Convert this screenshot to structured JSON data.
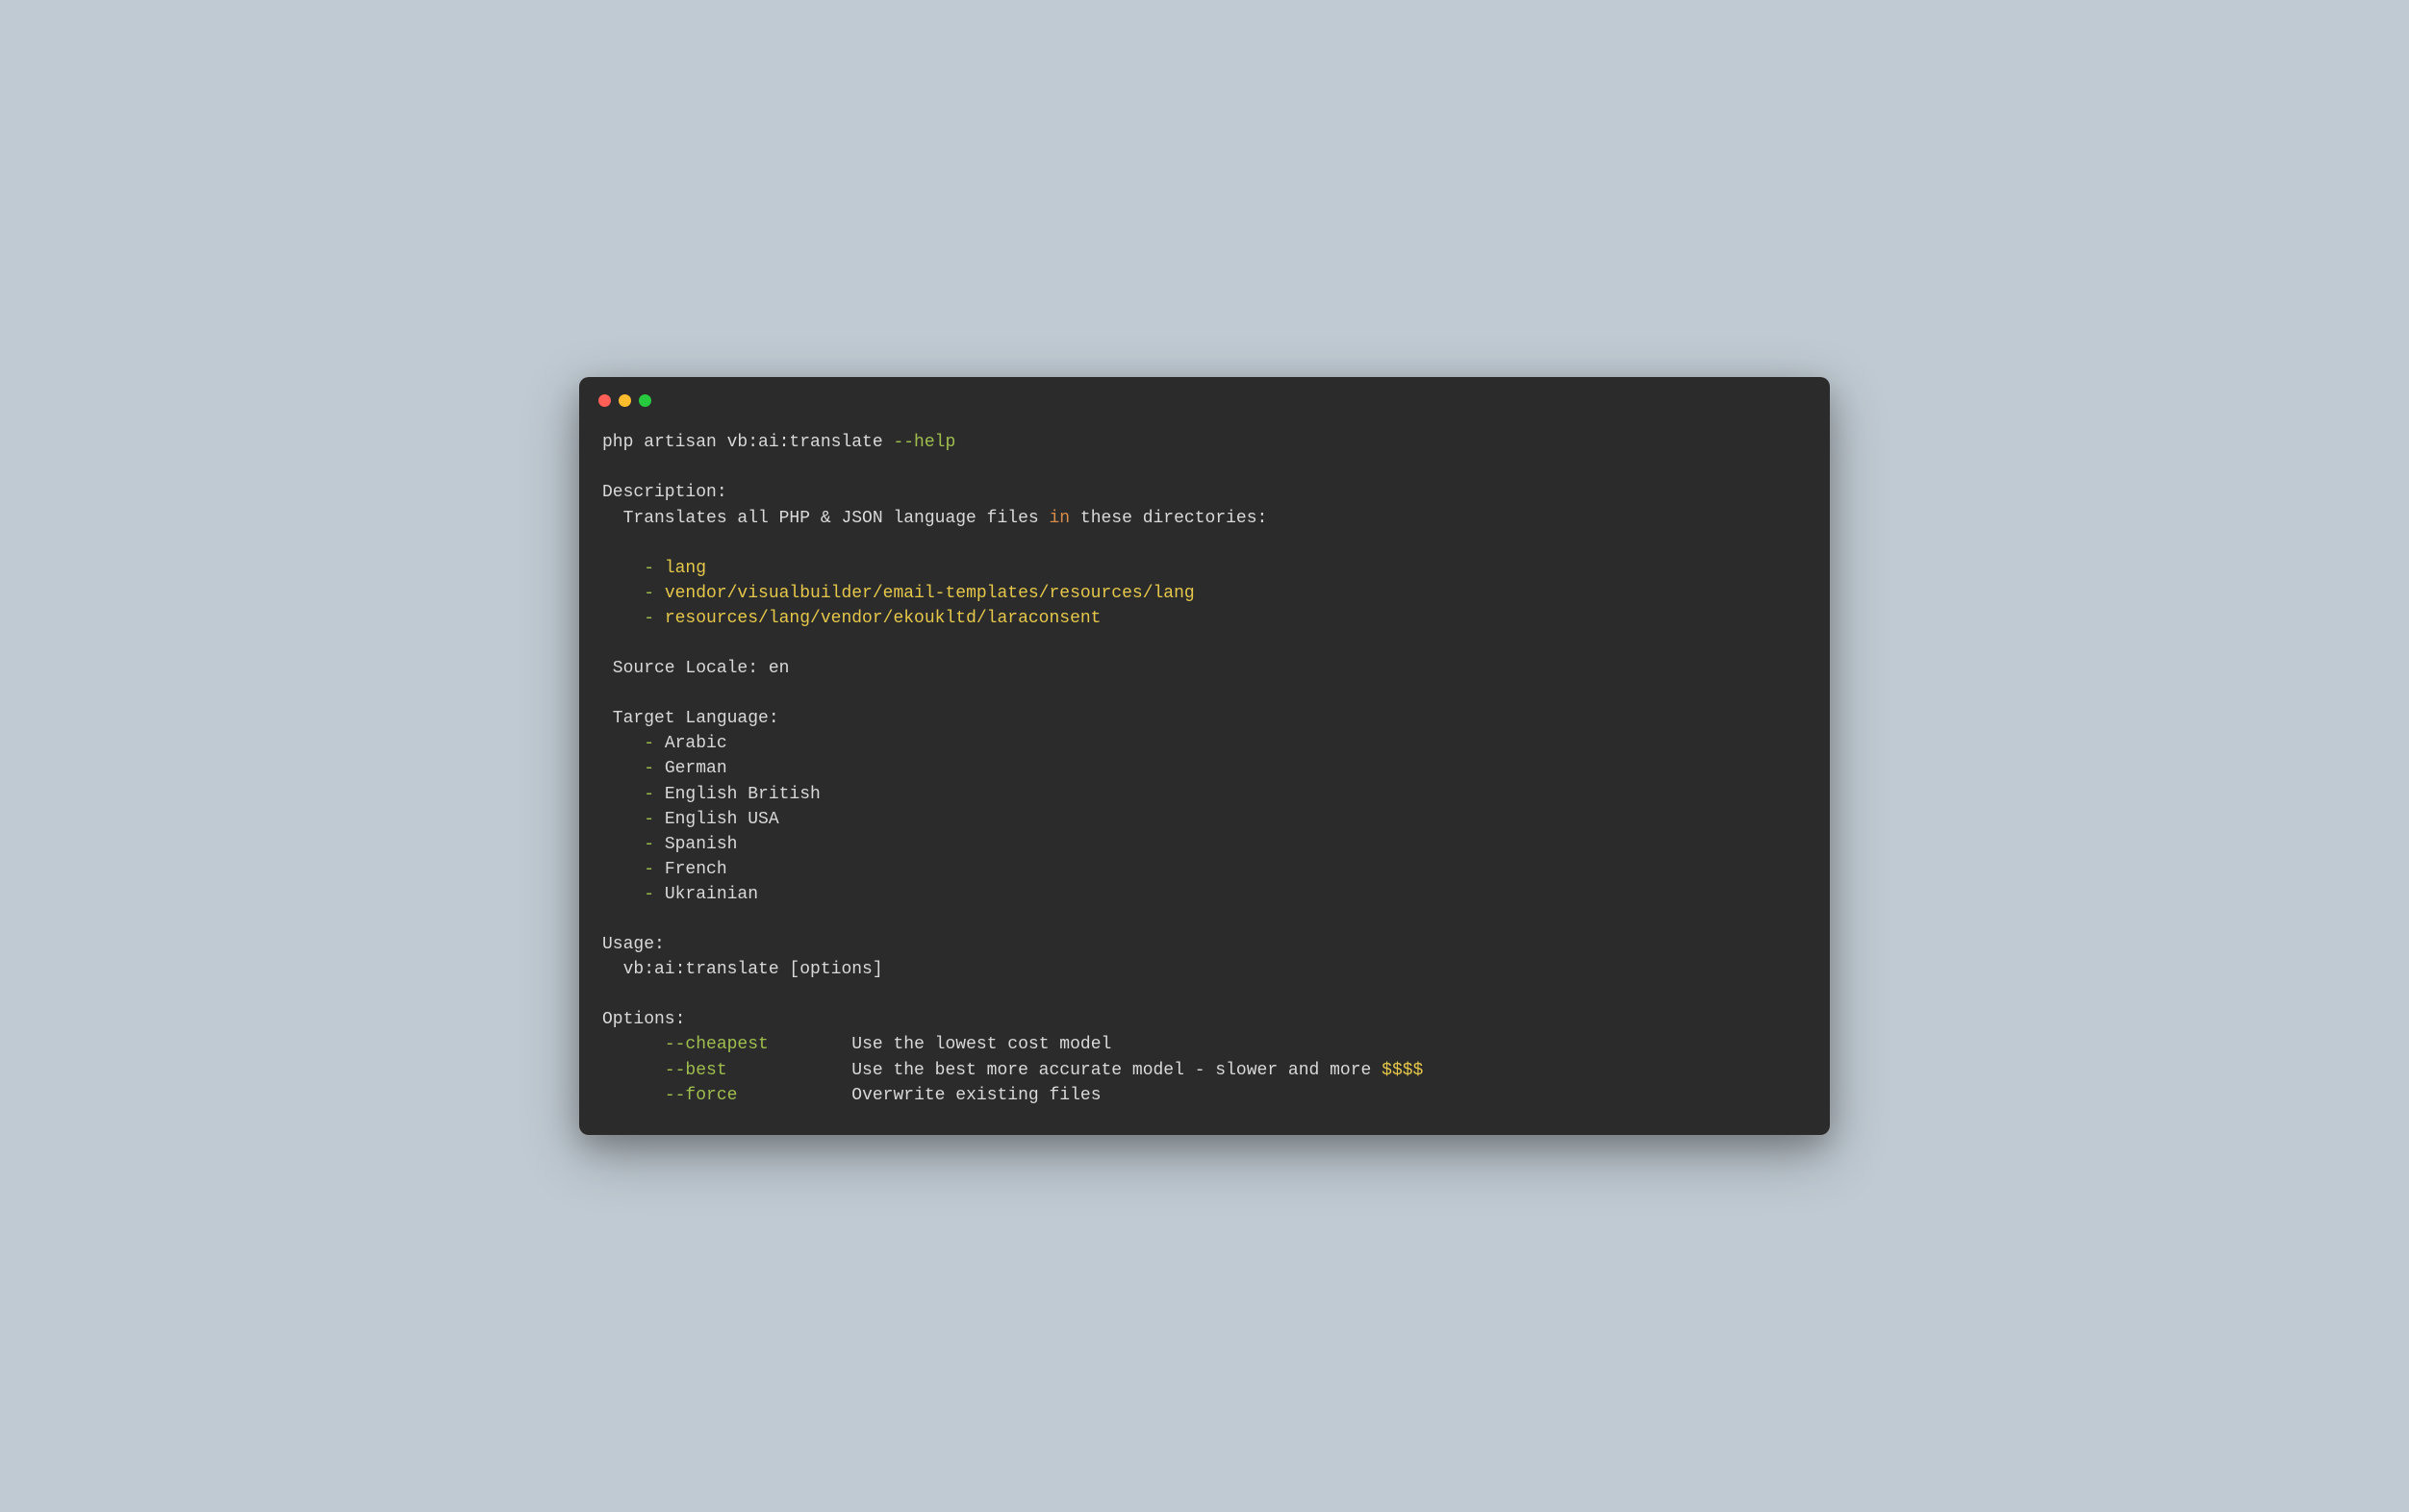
{
  "command": {
    "prefix": "php artisan vb:ai:translate ",
    "flag": "--help"
  },
  "description": {
    "header": "Description:",
    "text_before_in": "  Translates all PHP & JSON language files ",
    "in_keyword": "in",
    "text_after_in": " these directories:",
    "dirs": [
      {
        "dash": "    - ",
        "path": "lang"
      },
      {
        "dash": "    - ",
        "path": "vendor/visualbuilder/email-templates/resources/lang"
      },
      {
        "dash": "    - ",
        "path": "resources/lang/vendor/ekoukltd/laraconsent"
      }
    ]
  },
  "source_locale": " Source Locale: en",
  "target": {
    "header": " Target Language:",
    "langs": [
      {
        "dash": "    - ",
        "name": "Arabic"
      },
      {
        "dash": "    - ",
        "name": "German"
      },
      {
        "dash": "    - ",
        "name": "English British"
      },
      {
        "dash": "    - ",
        "name": "English USA"
      },
      {
        "dash": "    - ",
        "name": "Spanish"
      },
      {
        "dash": "    - ",
        "name": "French"
      },
      {
        "dash": "    - ",
        "name": "Ukrainian"
      }
    ]
  },
  "usage": {
    "header": "Usage:",
    "line": "  vb:ai:translate [options]"
  },
  "options": {
    "header": "Options:",
    "items": [
      {
        "pad": "      ",
        "flag": "--cheapest",
        "gap": "        ",
        "desc": "Use the lowest cost model",
        "suffix": ""
      },
      {
        "pad": "      ",
        "flag": "--best",
        "gap": "            ",
        "desc": "Use the best more accurate model - slower and more ",
        "suffix": "$$$$"
      },
      {
        "pad": "      ",
        "flag": "--force",
        "gap": "           ",
        "desc": "Overwrite existing files",
        "suffix": ""
      }
    ]
  }
}
